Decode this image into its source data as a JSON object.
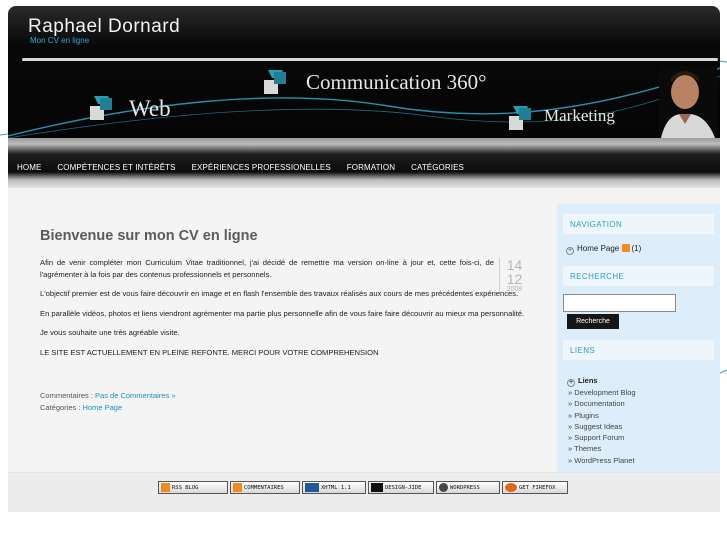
{
  "site": {
    "title": "Raphael Dornard",
    "subtitle": "Mon CV en ligne"
  },
  "banner": {
    "web": "Web",
    "communication": "Communication 360°",
    "marketing": "Marketing"
  },
  "nav": {
    "items": [
      {
        "label": "HOME"
      },
      {
        "label": "COMPÉTENCES ET INTÉRÊTS"
      },
      {
        "label": "EXPÉRIENCES PROFESSIONELLES"
      },
      {
        "label": "FORMATION"
      },
      {
        "label": "CATÉGORIES"
      }
    ]
  },
  "post": {
    "title": "Bienvenue sur mon CV en ligne",
    "date": {
      "day": "14",
      "month": "12",
      "year": "2008"
    },
    "paragraphs": [
      "Afin de venir compléter mon Curriculum Vitae traditionnel, j'ai décidé de remettre ma version on-line à jour et, cette fois-ci, de l'agrémenter à la fois par des contenus professionnels et personnels.",
      "L'objectif premier est de vous faire découvrir en image et en flash l'ensemble des travaux réalisés aux cours de mes précédentes expériences.",
      "En parallèle vidéos, photos et liens viendront agrémenter ma partie plus personnelle afin de vous faire faire découvrir au mieux ma personnalité.",
      "Je vous souhaite une très agréable visite.",
      "LE SITE EST ACTUELLEMENT EN PLEINE REFONTE. MERCI POUR VOTRE COMPREHENSION"
    ],
    "comments_label": "Commentaires :",
    "comments_link": "Pas de Commentaires »",
    "categories_label": "Catégories :",
    "categories_link": "Home Page"
  },
  "sidebar": {
    "navigation_heading": "NAVIGATION",
    "home_page": "Home Page",
    "home_count": "(1)",
    "search_heading": "RECHERCHE",
    "search_value": "",
    "search_button": "Recherche",
    "links_heading": "LIENS",
    "links_title": "Liens",
    "links": [
      "» Development Blog",
      "» Documentation",
      "» Plugins",
      "» Suggest Ideas",
      "» Support Forum",
      "» Themes",
      "» WordPress Planet"
    ]
  },
  "footer": {
    "badges": [
      {
        "label": "RSS BLOG",
        "icon": "rss-icon"
      },
      {
        "label": "COMMENTAIRES",
        "icon": "rss-icon"
      },
      {
        "label": "XHTML 1.1",
        "icon": "w3c-icon"
      },
      {
        "label": "DESIGN-JIDE",
        "icon": "design-icon"
      },
      {
        "label": "WORDPRESS",
        "icon": "wordpress-icon"
      },
      {
        "label": "GET FIREFOX",
        "icon": "firefox-icon"
      }
    ]
  },
  "colors": {
    "accent": "#2e9ccd",
    "header_bg": "#050505",
    "sidebar_bg": "#ddeefa",
    "rss": "#f28a1d"
  }
}
